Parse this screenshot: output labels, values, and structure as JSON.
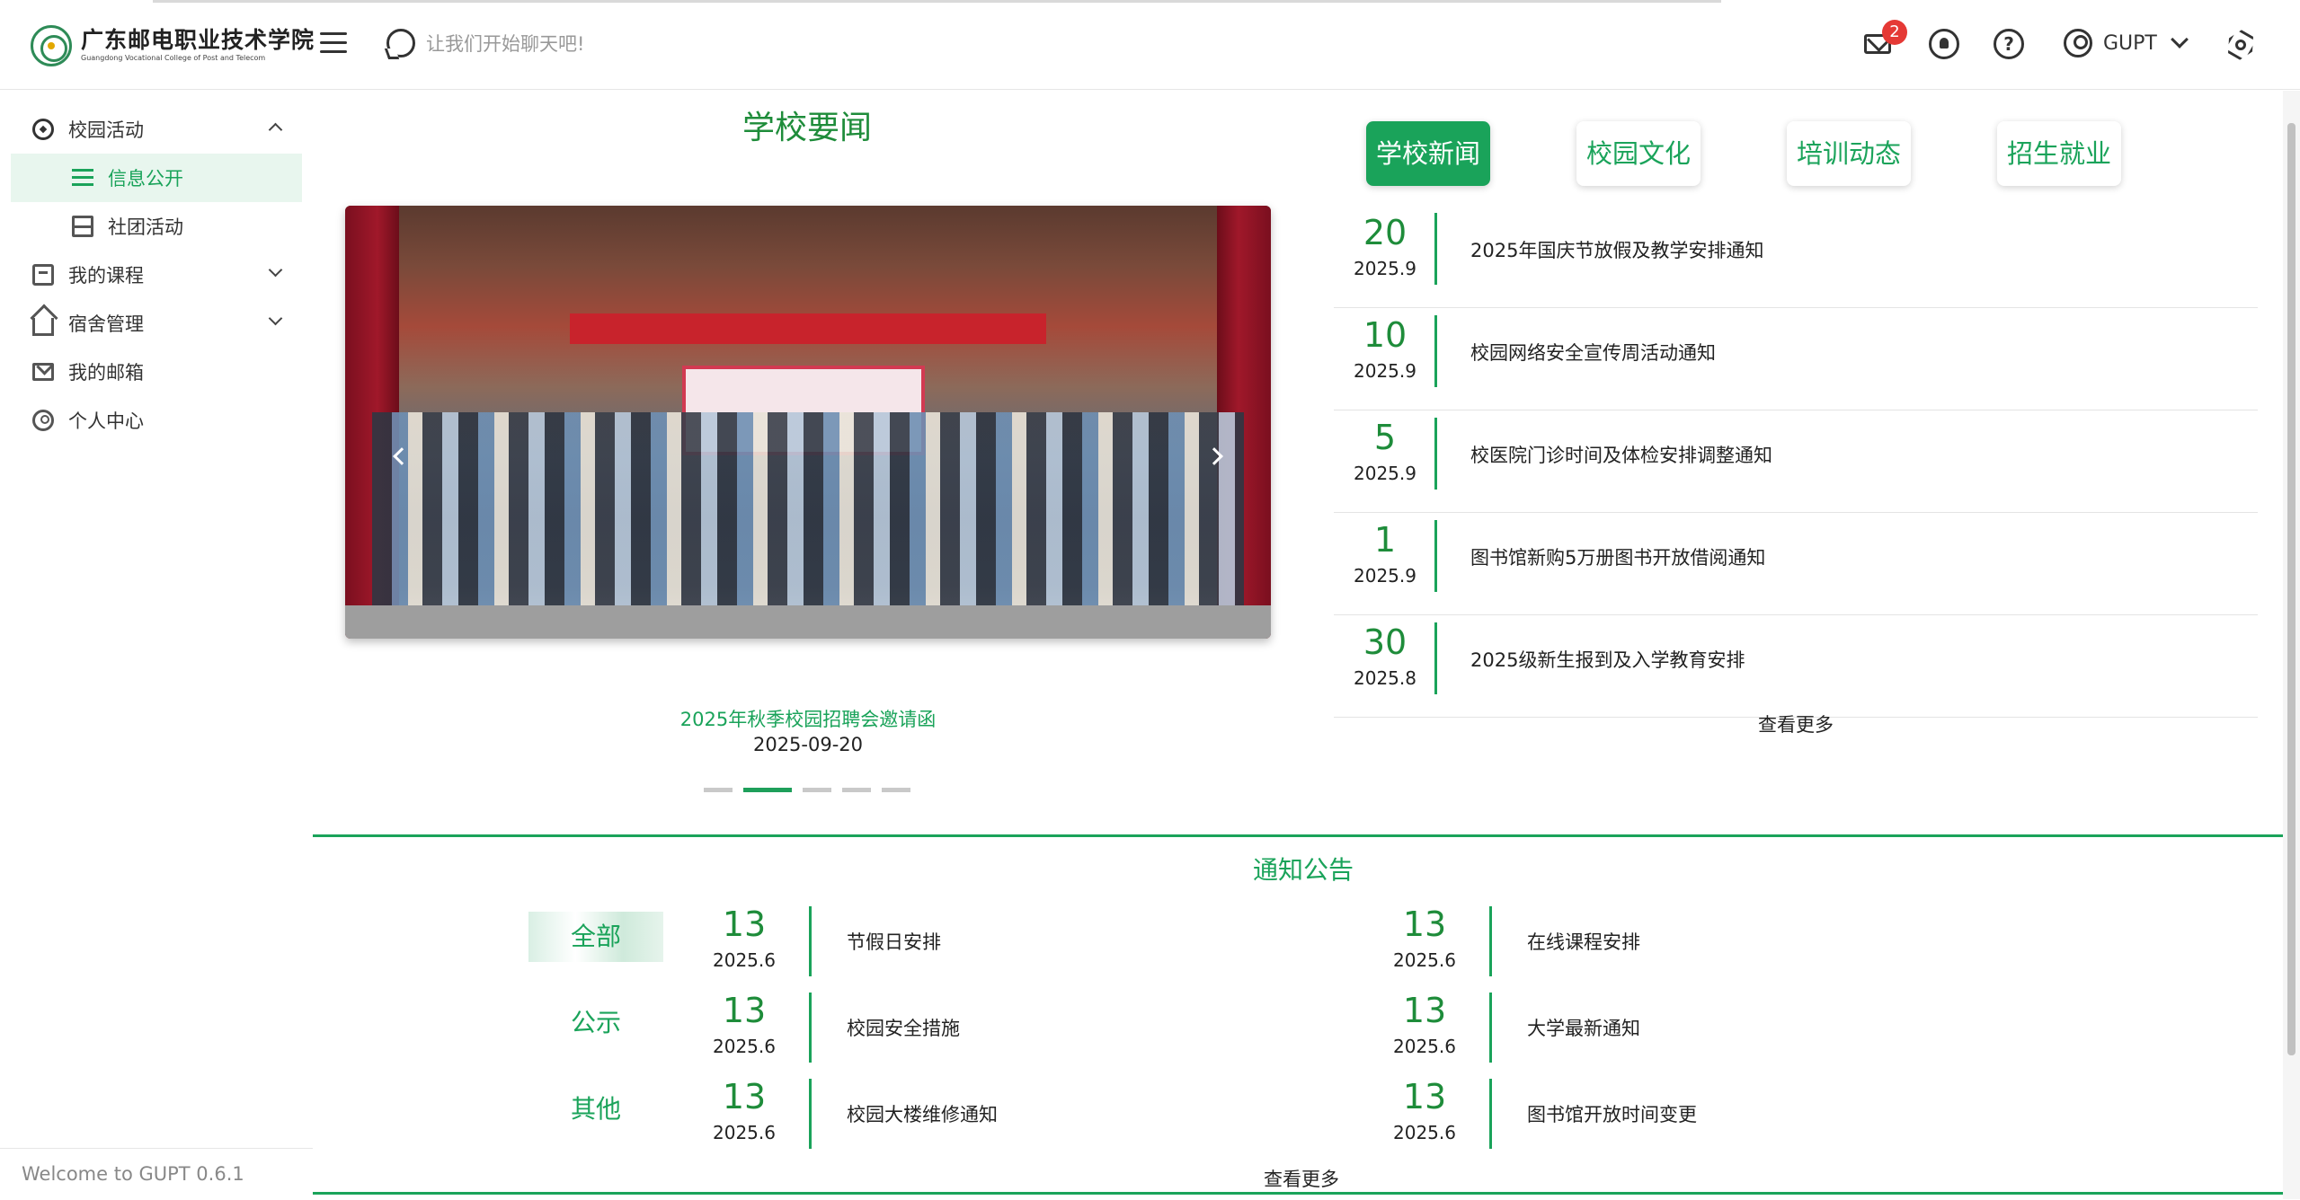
{
  "header": {
    "logo_cn": "广东邮电职业技术学院",
    "logo_en": "Guangdong Vocational College of Post and Telecom",
    "chat_placeholder": "让我们开始聊天吧!",
    "mail_badge": "2",
    "user_name": "GUPT",
    "icons": [
      "menu-icon",
      "chat-icon",
      "mail-icon",
      "github-icon",
      "help-icon",
      "user-icon",
      "settings-icon"
    ]
  },
  "sidebar": {
    "items": [
      {
        "label": "校园活动",
        "icon": "compass-icon",
        "expanded": true
      },
      {
        "label": "信息公开",
        "icon": "list-icon",
        "active": true
      },
      {
        "label": "社团活动",
        "icon": "board-icon"
      },
      {
        "label": "我的课程",
        "icon": "book-icon"
      },
      {
        "label": "宿舍管理",
        "icon": "home-icon"
      },
      {
        "label": "我的邮箱",
        "icon": "mail-icon"
      },
      {
        "label": "个人中心",
        "icon": "person-icon"
      }
    ],
    "footer": "Welcome to GUPT 0.6.1"
  },
  "school_news": {
    "title": "学校要闻",
    "carousel": {
      "caption_title": "2025年秋季校园招聘会邀请函",
      "caption_date": "2025-09-20",
      "slide_count": 5,
      "active_index": 1
    }
  },
  "news_tabs": {
    "tabs": [
      "学校新闻",
      "校园文化",
      "培训动态",
      "招生就业"
    ],
    "active": 0,
    "items": [
      {
        "day": "20",
        "ym": "2025.9",
        "title": "2025年国庆节放假及教学安排通知"
      },
      {
        "day": "10",
        "ym": "2025.9",
        "title": "校园网络安全宣传周活动通知"
      },
      {
        "day": "5",
        "ym": "2025.9",
        "title": "校医院门诊时间及体检安排调整通知"
      },
      {
        "day": "1",
        "ym": "2025.9",
        "title": "图书馆新购5万册图书开放借阅通知"
      },
      {
        "day": "30",
        "ym": "2025.8",
        "title": "2025级新生报到及入学教育安排"
      }
    ],
    "more": "查看更多"
  },
  "notices": {
    "title": "通知公告",
    "categories": [
      "全部",
      "公示",
      "其他"
    ],
    "active_category": 0,
    "left": [
      {
        "day": "13",
        "ym": "2025.6",
        "title": "节假日安排"
      },
      {
        "day": "13",
        "ym": "2025.6",
        "title": "校园安全措施"
      },
      {
        "day": "13",
        "ym": "2025.6",
        "title": "校园大楼维修通知"
      }
    ],
    "right": [
      {
        "day": "13",
        "ym": "2025.6",
        "title": "在线课程安排"
      },
      {
        "day": "13",
        "ym": "2025.6",
        "title": "大学最新通知"
      },
      {
        "day": "13",
        "ym": "2025.6",
        "title": "图书馆开放时间变更"
      }
    ],
    "more": "查看更多"
  },
  "colors": {
    "accent": "#1aa35a",
    "accent_dark": "#1e8c3a",
    "badge": "#e53935"
  }
}
